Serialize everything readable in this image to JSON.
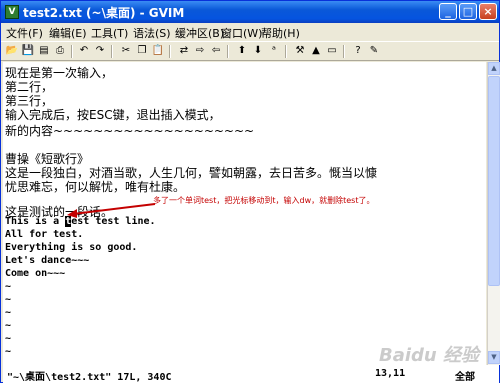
{
  "window": {
    "title": "test2.txt (~\\桌面) - GVIM"
  },
  "menubar": {
    "items": [
      "文件(F)",
      "编辑(E)",
      "工具(T)",
      "语法(S)",
      "缓冲区(B)",
      "窗口(W)",
      "帮助(H)"
    ]
  },
  "editor": {
    "lines": [
      "现在是第一次输入，",
      "第二行，",
      "第三行，",
      "输入完成后，按ESC键，退出插入模式，",
      "",
      "新的内容~~~~~~~~~~~~~~~~~~~~",
      "",
      "曹操《短歌行》",
      "这是一段独白，对酒当歌，人生几何，譬如朝露，去日苦多。慨当以慷",
      "忧思难忘，何以解忧，唯有杜康。",
      "",
      "这是测试的一段话。"
    ],
    "code_lines": [
      {
        "before": "This is a ",
        "cursor": "t",
        "after": "est test line."
      },
      {
        "before": "All for test.",
        "cursor": "",
        "after": ""
      },
      {
        "before": "Everything is so good.",
        "cursor": "",
        "after": ""
      },
      {
        "before": "Let's dance~~~",
        "cursor": "",
        "after": ""
      },
      {
        "before": "Come on~~~",
        "cursor": "",
        "after": ""
      }
    ],
    "tilde": "~"
  },
  "annotation": {
    "text": "多了一个单词test，把光标移动到t，输入dw，就删除test了。",
    "color": "#c40000"
  },
  "status": {
    "file": "\"~\\桌面\\test2.txt\" 17L, 340C",
    "position": "13,11",
    "scroll": "全部"
  },
  "watermark": {
    "text": "Baidu 经验"
  }
}
